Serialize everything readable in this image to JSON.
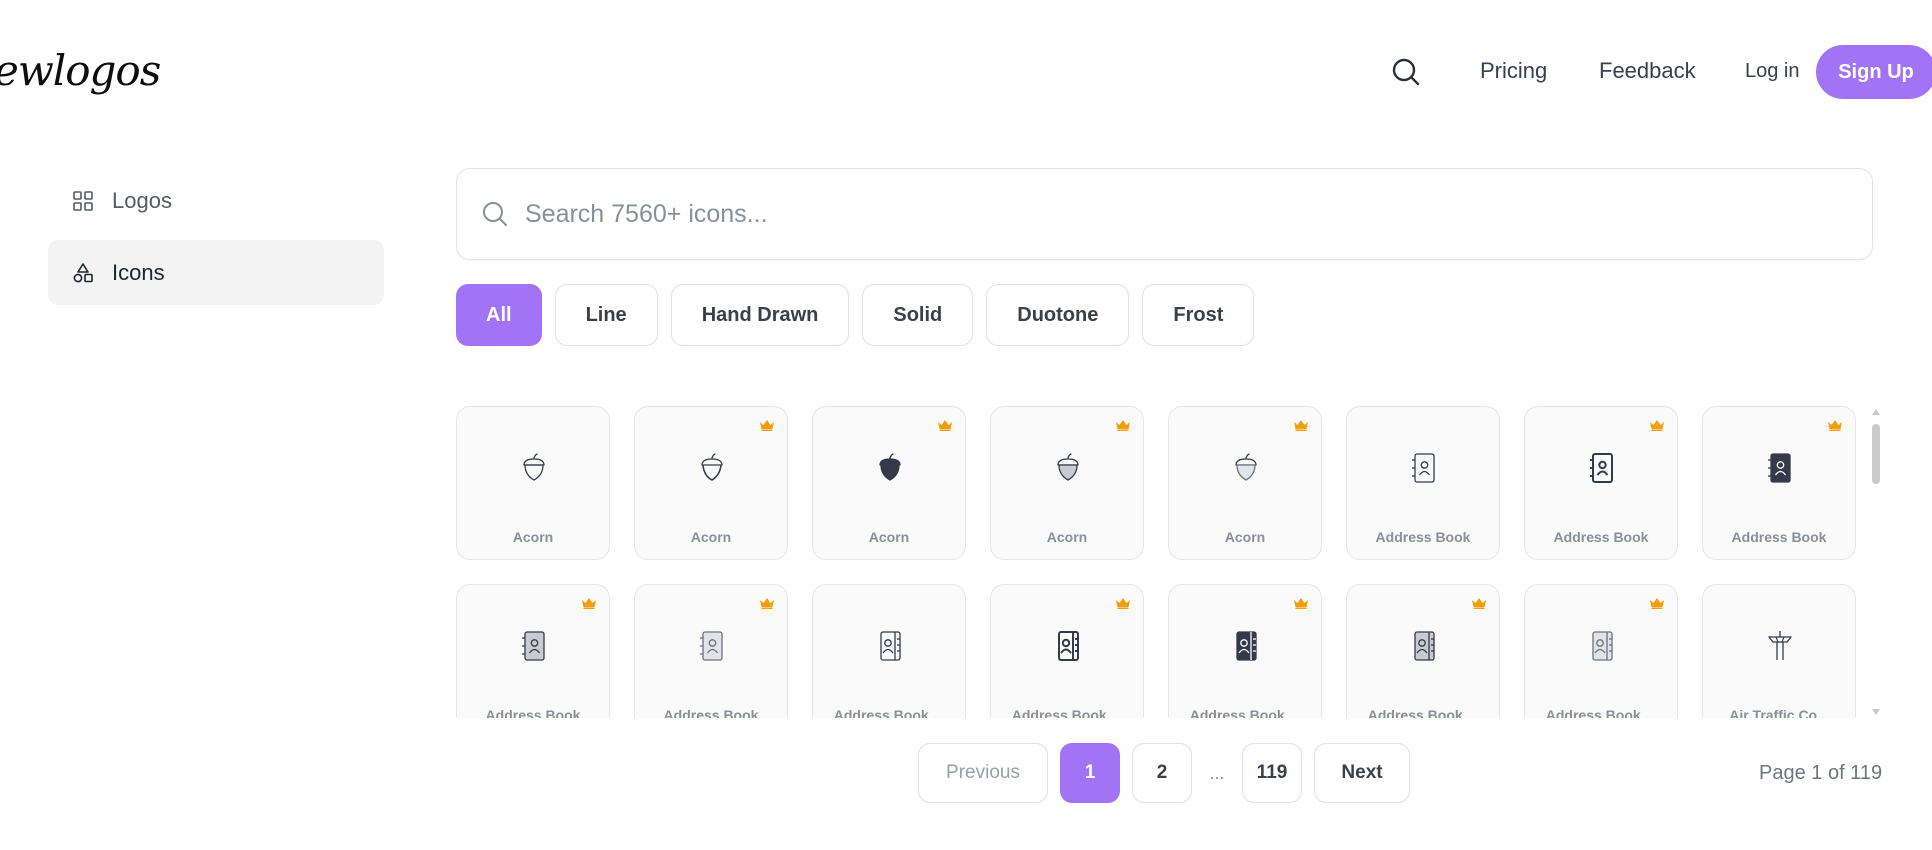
{
  "header": {
    "logo_text": "ewlogos",
    "nav": {
      "pricing": "Pricing",
      "feedback": "Feedback",
      "login": "Log in",
      "signup": "Sign Up"
    }
  },
  "sidebar": {
    "items": [
      {
        "label": "Logos",
        "icon": "grid-icon",
        "active": false
      },
      {
        "label": "Icons",
        "icon": "shapes-icon",
        "active": true
      }
    ]
  },
  "search": {
    "placeholder": "Search 7560+ icons...",
    "value": ""
  },
  "filters": [
    "All",
    "Line",
    "Hand Drawn",
    "Solid",
    "Duotone",
    "Frost"
  ],
  "active_filter": "All",
  "icons": [
    {
      "name": "Acorn",
      "glyph": "acorn-line",
      "premium": false
    },
    {
      "name": "Acorn",
      "glyph": "acorn-handdrawn",
      "premium": true
    },
    {
      "name": "Acorn",
      "glyph": "acorn-solid",
      "premium": true
    },
    {
      "name": "Acorn",
      "glyph": "acorn-duotone",
      "premium": true
    },
    {
      "name": "Acorn",
      "glyph": "acorn-frost",
      "premium": true
    },
    {
      "name": "Address Book",
      "glyph": "addressbook-line",
      "premium": false
    },
    {
      "name": "Address Book",
      "glyph": "addressbook-bold",
      "premium": true
    },
    {
      "name": "Address Book",
      "glyph": "addressbook-solid",
      "premium": true
    },
    {
      "name": "Address Book",
      "glyph": "addressbook-duotone",
      "premium": true
    },
    {
      "name": "Address Book",
      "glyph": "addressbook-frost",
      "premium": true
    },
    {
      "name": "Address Book ...",
      "glyph": "addressbook-tabs-line",
      "premium": false
    },
    {
      "name": "Address Book ...",
      "glyph": "addressbook-tabs-bold",
      "premium": true
    },
    {
      "name": "Address Book ...",
      "glyph": "addressbook-tabs-solid",
      "premium": true
    },
    {
      "name": "Address Book ...",
      "glyph": "addressbook-tabs-duotone",
      "premium": true
    },
    {
      "name": "Address Book ...",
      "glyph": "addressbook-tabs-frost",
      "premium": true
    },
    {
      "name": "Air Traffic Co...",
      "glyph": "air-traffic-control",
      "premium": false
    }
  ],
  "pagination": {
    "previous": "Previous",
    "pages": [
      "1",
      "2"
    ],
    "ellipsis": "...",
    "last": "119",
    "next": "Next",
    "current": "1",
    "info": "Page 1 of 119"
  },
  "colors": {
    "accent": "#a274f5",
    "crown": "#f59e0b",
    "icon_dark": "#343a4a"
  }
}
